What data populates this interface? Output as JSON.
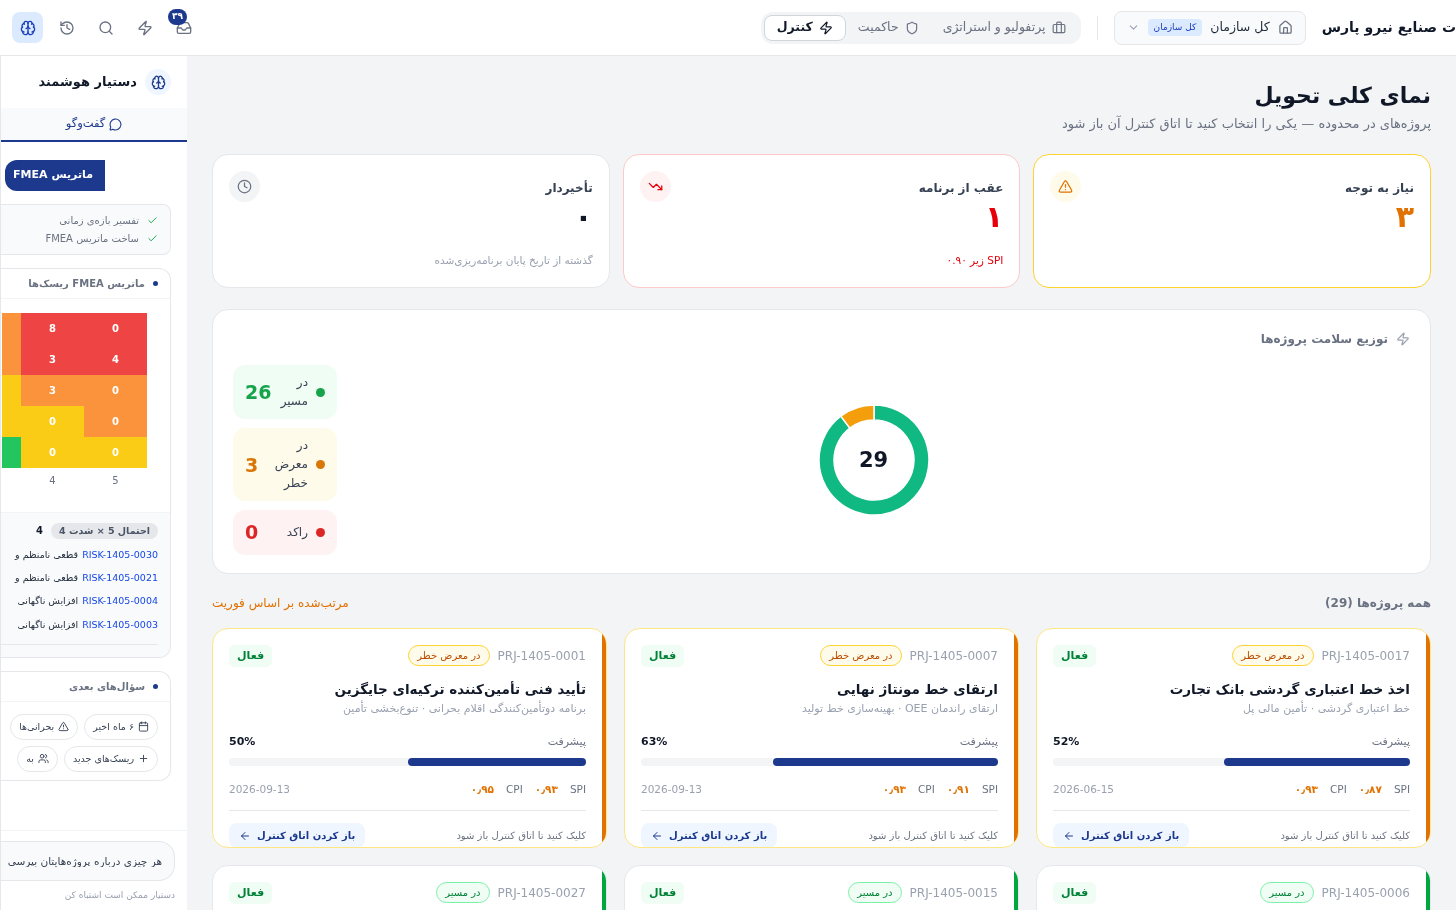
{
  "header": {
    "brand": "ت صنایع نیرو پارس",
    "scope": {
      "label": "کل سازمان",
      "badge": "کل سازمان"
    },
    "tabs": [
      {
        "label": "پرتفولیو و استراتژی",
        "selected": false
      },
      {
        "label": "حاکمیت",
        "selected": false
      },
      {
        "label": "کنترل",
        "selected": true
      }
    ],
    "toolbar": [
      {
        "badge": "۳۹",
        "selected": false
      },
      {
        "selected": false
      },
      {
        "selected": false
      },
      {
        "selected": false
      },
      {
        "selected": true
      }
    ]
  },
  "page": {
    "title": "نمای کلی تحویل",
    "subtitle": "پروژه‌های در محدوده — یکی را انتخاب کنید تا اتاق کنترل آن باز شود"
  },
  "kpis": [
    {
      "kind": "warning",
      "title": "نیاز به توجه",
      "value": "۳"
    },
    {
      "kind": "danger",
      "title": "عقب از برنامه",
      "value": "۱",
      "note": "SPI زیر ۰.۹۰"
    },
    {
      "kind": "neutral",
      "title": "تأخیردار",
      "value": "۰",
      "note": "گذشته از تاریخ پایان برنامه‌ریزی‌شده"
    }
  ],
  "health": {
    "title": "توزیع سلامت پروژه‌ها",
    "total": "29",
    "legend": [
      {
        "value": "26",
        "color": "#16a34a"
      },
      {
        "value": "3",
        "color": "#d97706"
      },
      {
        "value": "0",
        "color": "#dc2626"
      }
    ],
    "chart_data": {
      "type": "donut",
      "categories": [
        "در مسیر",
        "در معرض خطر",
        "راکد"
      ],
      "values": [
        89.7,
        10.3,
        0
      ]
    }
  },
  "projects": {
    "title": "همه پروژه‌ها (29)",
    "sort": "مرتب‌شده بر اساس فوریت",
    "items": [
      {
        "id": "PRJ-1405-0017",
        "status": "در معرض خطر",
        "kind": "at_risk",
        "state": "فعال",
        "title": "اخذ خط اعتباری گردشی بانک تجارت",
        "subtitle": "خط اعتباری گردشی · تأمین مالی پل",
        "progress_label": "پیشرفت",
        "progress": "52%",
        "level": 0.52,
        "spi_label": "SPI",
        "spi": "۰٫۸۷",
        "cpi_label": "CPI",
        "cpi": "۰٫۹۳",
        "date": "2026-06-15",
        "hint": "کلیک کنید تا اتاق کنترل باز شود",
        "action": "باز کردن اتاق کنترل"
      },
      {
        "id": "PRJ-1405-0007",
        "status": "در معرض خطر",
        "kind": "at_risk",
        "state": "فعال",
        "title": "ارتقای خط مونتاژ نهایی",
        "subtitle": "ارتقای راندمان OEE · بهینه‌سازی خط تولید",
        "progress_label": "پیشرفت",
        "progress": "63%",
        "level": 0.63,
        "spi_label": "SPI",
        "spi": "۰٫۹۱",
        "cpi_label": "CPI",
        "cpi": "۰٫۹۳",
        "date": "2026-09-13",
        "hint": "کلیک کنید تا اتاق کنترل باز شود",
        "action": "باز کردن اتاق کنترل"
      },
      {
        "id": "PRJ-1405-0001",
        "status": "در معرض خطر",
        "kind": "at_risk",
        "state": "فعال",
        "title": "تأیید فنی تأمین‌کننده ترکیه‌ای جایگزین",
        "subtitle": "برنامه دوتأمین‌کنندگی اقلام بحرانی · تنوع‌بخشی تأمین",
        "progress_label": "پیشرفت",
        "progress": "50%",
        "level": 0.5,
        "spi_label": "SPI",
        "spi": "۰٫۹۳",
        "cpi_label": "CPI",
        "cpi": "۰٫۹۵",
        "date": "2026-09-13",
        "hint": "کلیک کنید تا اتاق کنترل باز شود",
        "action": "باز کردن اتاق کنترل"
      },
      {
        "id": "PRJ-1405-0006",
        "status": "در مسیر",
        "kind": "on_track",
        "state": "فعال"
      },
      {
        "id": "PRJ-1405-0015",
        "status": "در مسیر",
        "kind": "on_track",
        "state": "فعال"
      },
      {
        "id": "PRJ-1405-0027",
        "status": "در مسیر",
        "kind": "on_track",
        "state": "فعال"
      }
    ]
  },
  "assistant": {
    "title": "دستیار هوشمند",
    "tabs": [
      {
        "label": "گفت‌وگو",
        "selected": true
      }
    ],
    "message": "ماتریس FMEA",
    "steps": [
      {
        "label": "تفسیر بازه‌ی زمانی",
        "done": true
      },
      {
        "label": "ساخت ماتریس FMEA",
        "done": true
      }
    ],
    "matrix": {
      "title": "ماتریس FMEA ریسک‌ها",
      "rows": [
        [
          {
            "value": "0",
            "color": "#ef4444"
          },
          {
            "value": "8",
            "color": "#ef4444"
          },
          {
            "color": "#fb923c"
          }
        ],
        [
          {
            "value": "4",
            "color": "#ef4444"
          },
          {
            "value": "3",
            "color": "#ef4444"
          },
          {
            "color": "#fb923c"
          }
        ],
        [
          {
            "value": "0",
            "color": "#fb923c"
          },
          {
            "value": "3",
            "color": "#fb923c"
          },
          {
            "color": "#facc15"
          }
        ],
        [
          {
            "value": "0",
            "color": "#fb923c"
          },
          {
            "value": "0",
            "color": "#facc15"
          },
          {
            "color": "#facc15"
          }
        ],
        [
          {
            "value": "0",
            "color": "#facc15"
          },
          {
            "value": "0",
            "color": "#facc15"
          },
          {
            "color": "#22c55e"
          }
        ]
      ],
      "x_labels": [
        "5",
        "4"
      ],
      "selection": {
        "badge": "احتمال 5 × شدت 4",
        "count": "4"
      },
      "risks": [
        {
          "id": "RISK-1405-0030",
          "title": "قطعی نامنظم و"
        },
        {
          "id": "RISK-1405-0021",
          "title": "قطعی نامنظم و"
        },
        {
          "id": "RISK-1405-0004",
          "title": "افزایش ناگهانی"
        },
        {
          "id": "RISK-1405-0003",
          "title": "افزایش ناگهانی"
        }
      ]
    },
    "followups": {
      "title": "سؤال‌های بعدی",
      "chips": [
        {
          "label": "۶ ماه اخیر"
        },
        {
          "label": "بحرانی‌ها"
        },
        {
          "label": "ریسک‌های جدید"
        },
        {
          "label": "به"
        }
      ]
    },
    "input": {
      "placeholder": "هر چیزی درباره پروژه‌هایتان بپرسی"
    },
    "disclaimer": "دستیار ممکن است اشتباه کن"
  }
}
